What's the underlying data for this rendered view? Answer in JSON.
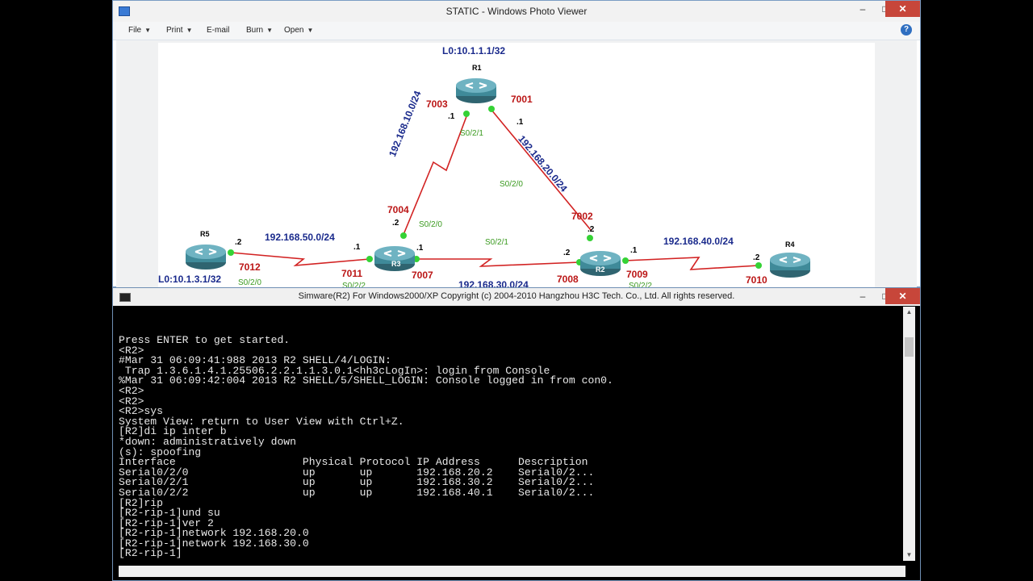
{
  "photo_viewer": {
    "title": "STATIC - Windows Photo Viewer",
    "controls": {
      "minimize": "–",
      "maximize": "□",
      "close": "✕"
    },
    "menu": [
      {
        "label": "File",
        "has_caret": true
      },
      {
        "label": "Print",
        "has_caret": true
      },
      {
        "label": "E-mail",
        "has_caret": false
      },
      {
        "label": "Burn",
        "has_caret": true
      },
      {
        "label": "Open",
        "has_caret": true
      }
    ],
    "help": "?"
  },
  "topology": {
    "routers": [
      {
        "name": "R1",
        "loopback": "L0:10.1.1.1/32"
      },
      {
        "name": "R2"
      },
      {
        "name": "R3"
      },
      {
        "name": "R4"
      },
      {
        "name": "R5",
        "loopback": "L0:10.1.3.1/32"
      }
    ],
    "networks": [
      "192.168.10.0/24",
      "192.168.20.0/24",
      "192.168.50.0/24",
      "192.168.30.0/24",
      "192.168.40.0/24"
    ],
    "ports": [
      "7001",
      "7002",
      "7003",
      "7004",
      "7007",
      "7008",
      "7009",
      "7010",
      "7011",
      "7012"
    ],
    "interfaces": [
      "S0/2/1",
      "S0/2/0",
      "S0/2/0",
      "S0/2/1",
      "S0/2/0",
      "S0/2/2",
      "S0/2/2"
    ],
    "host_ids": [
      ".1",
      ".1",
      ".2",
      ".2",
      ".2",
      ".1",
      ".1",
      ".2",
      ".2",
      ".1"
    ]
  },
  "console": {
    "title": "Simware(R2) For Windows2000/XP Copyright (c) 2004-2010 Hangzhou H3C Tech. Co., Ltd. All rights reserved.",
    "controls": {
      "minimize": "–",
      "maximize": "□",
      "close": "✕"
    },
    "lines": [
      "Press ENTER to get started.",
      "<R2>",
      "#Mar 31 06:09:41:988 2013 R2 SHELL/4/LOGIN:",
      " Trap 1.3.6.1.4.1.25506.2.2.1.1.3.0.1<hh3cLogIn>: login from Console",
      "%Mar 31 06:09:42:004 2013 R2 SHELL/5/SHELL_LOGIN: Console logged in from con0.",
      "<R2>",
      "<R2>",
      "<R2>sys",
      "System View: return to User View with Ctrl+Z.",
      "[R2]di ip inter b",
      "*down: administratively down",
      "(s): spoofing",
      "Interface                    Physical Protocol IP Address      Description",
      "Serial0/2/0                  up       up       192.168.20.2    Serial0/2...",
      "Serial0/2/1                  up       up       192.168.30.2    Serial0/2...",
      "Serial0/2/2                  up       up       192.168.40.1    Serial0/2...",
      "[R2]rip",
      "[R2-rip-1]und su",
      "[R2-rip-1]ver 2",
      "[R2-rip-1]network 192.168.20.0",
      "[R2-rip-1]network 192.168.30.0",
      "[R2-rip-1]"
    ]
  }
}
